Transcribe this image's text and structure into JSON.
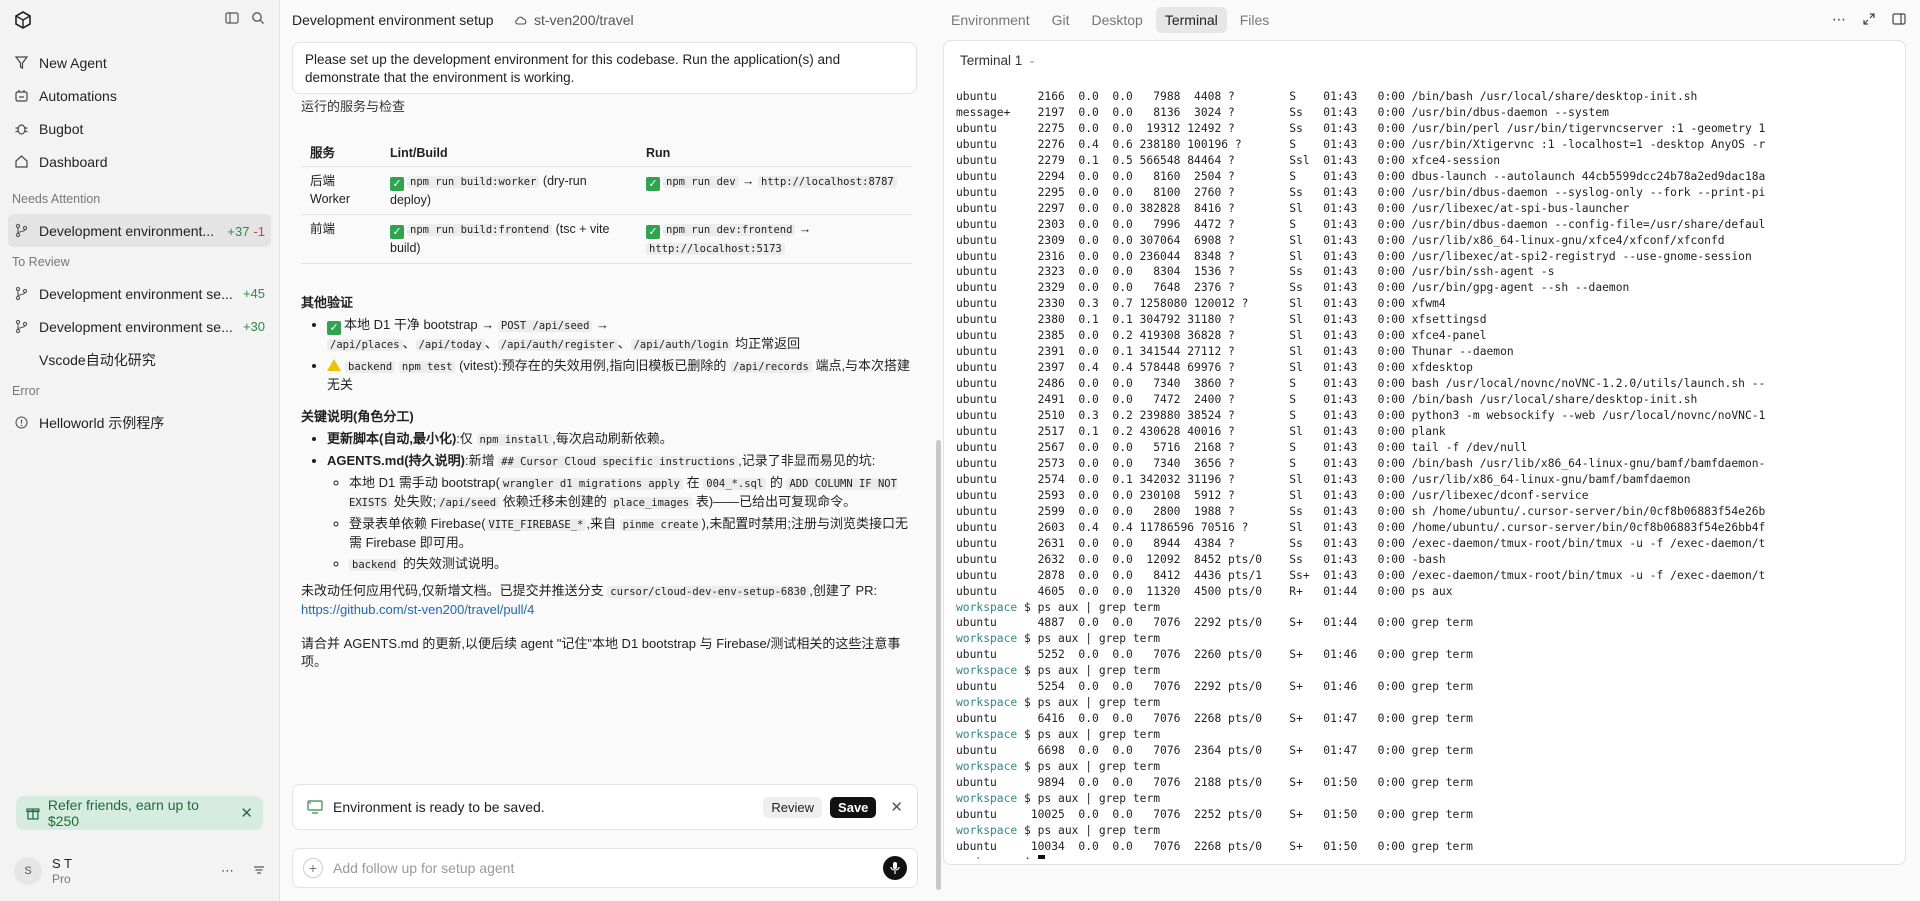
{
  "app": {
    "title": "Development environment setup",
    "repo": "st-ven200/travel"
  },
  "sidebar": {
    "nav": [
      {
        "label": "New Agent",
        "icon": "new-agent-icon"
      },
      {
        "label": "Automations",
        "icon": "automations-icon"
      },
      {
        "label": "Bugbot",
        "icon": "bug-icon"
      },
      {
        "label": "Dashboard",
        "icon": "home-icon"
      }
    ],
    "sections": {
      "needs_attention": "Needs Attention",
      "to_review": "To Review",
      "error": "Error"
    },
    "needs_attention": [
      {
        "title": "Development environment...",
        "added": "+37",
        "removed": "-1"
      }
    ],
    "to_review": [
      {
        "title": "Development environment se...",
        "added": "+45"
      },
      {
        "title": "Development environment se...",
        "added": "+30"
      },
      {
        "title": "Vscode自动化研究"
      }
    ],
    "errors": [
      {
        "title": "Helloworld 示例程序"
      }
    ],
    "refer": "Refer friends, earn up to $250",
    "user": {
      "initial": "S",
      "name": "S T",
      "plan": "Pro"
    }
  },
  "tabs": [
    "Environment",
    "Git",
    "Desktop",
    "Terminal",
    "Files"
  ],
  "chat": {
    "user_message": "Please set up the development environment for this codebase. Run the application(s) and demonstrate that the environment is working.",
    "running_heading": "运行的服务与检查",
    "table": {
      "headers": [
        "服务",
        "Lint/Build",
        "Run"
      ],
      "rows": [
        {
          "service": "后端 Worker",
          "build_code": "npm run build:worker",
          "build_note": "(dry-run deploy)",
          "run_code": "npm run dev",
          "run_url": "http://localhost:8787"
        },
        {
          "service": "前端",
          "build_code": "npm run build:frontend",
          "build_note": "(tsc + vite build)",
          "run_code": "npm run dev:frontend",
          "run_url": "http://localhost:5173"
        }
      ]
    },
    "other_heading": "其他验证",
    "other_1_pre": "本地 D1 干净 bootstrap →",
    "other_1_codes": [
      "POST /api/seed",
      "/api/places",
      "/api/today",
      "/api/auth/register",
      "/api/auth/login"
    ],
    "other_1_post": "均正常返回",
    "other_2_codes": [
      "backend",
      "npm test"
    ],
    "other_2_text": "(vitest):预存在的失效用例,指向旧模板已删除的",
    "other_2_code3": "/api/records",
    "other_2_post": "端点,与本次搭建无关",
    "key_heading": "关键说明(角色分工)",
    "key_1_bold": "更新脚本(自动,最小化)",
    "key_1_text": ":仅",
    "key_1_code": "npm install",
    "key_1_post": ",每次启动刷新依赖。",
    "key_2_bold": "AGENTS.md(持久说明)",
    "key_2_text": ":新增",
    "key_2_code": "## Cursor Cloud specific instructions",
    "key_2_post": ",记录了非显而易见的坑:",
    "sub_1_a": "本地 D1 需手动 bootstrap(",
    "sub_1_code1": "wrangler d1 migrations apply",
    "sub_1_b": "在",
    "sub_1_code2": "004_*.sql",
    "sub_1_c": "的",
    "sub_1_code3": "ADD COLUMN IF NOT EXISTS",
    "sub_1_d": "处失败;",
    "sub_1_code4": "/api/seed",
    "sub_1_e": "依赖迁移未创建的",
    "sub_1_code5": "place_images",
    "sub_1_f": "表)——已给出可复现命令。",
    "sub_2_a": "登录表单依赖 Firebase(",
    "sub_2_code1": "VITE_FIREBASE_*",
    "sub_2_b": ",来自",
    "sub_2_code2": "pinme create",
    "sub_2_c": "),未配置时禁用;注册与浏览类接口无需 Firebase 即可用。",
    "sub_3_code": "backend",
    "sub_3_text": "的失效测试说明。",
    "pr_text": "未改动任何应用代码,仅新增文档。已提交并推送分支",
    "pr_branch": "cursor/cloud-dev-env-setup-6830",
    "pr_post": ",创建了 PR:",
    "pr_link": "https://github.com/st-ven200/travel/pull/4",
    "closing": "请合并 AGENTS.md 的更新,以便后续 agent \"记住\"本地 D1 bootstrap 与 Firebase/测试相关的这些注意事项。",
    "ready_text": "Environment is ready to be saved.",
    "review_label": "Review",
    "save_label": "Save",
    "followup_placeholder": "Add follow up for setup agent"
  },
  "terminal": {
    "tab_label": "Terminal 1",
    "lines": [
      "ubuntu      2166  0.0  0.0   7988  4408 ?        S    01:43   0:00 /bin/bash /usr/local/share/desktop-init.sh",
      "message+    2197  0.0  0.0   8136  3024 ?        Ss   01:43   0:00 /usr/bin/dbus-daemon --system",
      "ubuntu      2275  0.0  0.0  19312 12492 ?        Ss   01:43   0:00 /usr/bin/perl /usr/bin/tigervncserver :1 -geometry 1",
      "ubuntu      2276  0.4  0.6 238180 100196 ?       S    01:43   0:00 /usr/bin/Xtigervnc :1 -localhost=1 -desktop AnyOS -r",
      "ubuntu      2279  0.1  0.5 566548 84464 ?        Ssl  01:43   0:00 xfce4-session",
      "ubuntu      2294  0.0  0.0   8160  2504 ?        S    01:43   0:00 dbus-launch --autolaunch 44cb5599dcc24b78a2ed9dac18a",
      "ubuntu      2295  0.0  0.0   8100  2760 ?        Ss   01:43   0:00 /usr/bin/dbus-daemon --syslog-only --fork --print-pi",
      "ubuntu      2297  0.0  0.0 382828  8416 ?        Sl   01:43   0:00 /usr/libexec/at-spi-bus-launcher",
      "ubuntu      2303  0.0  0.0   7996  4472 ?        S    01:43   0:00 /usr/bin/dbus-daemon --config-file=/usr/share/defaul",
      "ubuntu      2309  0.0  0.0 307064  6908 ?        Sl   01:43   0:00 /usr/lib/x86_64-linux-gnu/xfce4/xfconf/xfconfd",
      "ubuntu      2316  0.0  0.0 236044  8348 ?        Sl   01:43   0:00 /usr/libexec/at-spi2-registryd --use-gnome-session",
      "ubuntu      2323  0.0  0.0   8304  1536 ?        Ss   01:43   0:00 /usr/bin/ssh-agent -s",
      "ubuntu      2329  0.0  0.0   7648  2376 ?        Ss   01:43   0:00 /usr/bin/gpg-agent --sh --daemon",
      "ubuntu      2330  0.3  0.7 1258080 120012 ?      Sl   01:43   0:00 xfwm4",
      "ubuntu      2380  0.1  0.1 304792 31180 ?        Sl   01:43   0:00 xfsettingsd",
      "ubuntu      2385  0.0  0.2 419308 36828 ?        Sl   01:43   0:00 xfce4-panel",
      "ubuntu      2391  0.0  0.1 341544 27112 ?        Sl   01:43   0:00 Thunar --daemon",
      "ubuntu      2397  0.4  0.4 578448 69976 ?        Sl   01:43   0:00 xfdesktop",
      "ubuntu      2486  0.0  0.0   7340  3860 ?        S    01:43   0:00 bash /usr/local/novnc/noVNC-1.2.0/utils/launch.sh --",
      "ubuntu      2491  0.0  0.0   7472  2400 ?        S    01:43   0:00 /bin/bash /usr/local/share/desktop-init.sh",
      "ubuntu      2510  0.3  0.2 239880 38524 ?        S    01:43   0:00 python3 -m websockify --web /usr/local/novnc/noVNC-1",
      "ubuntu      2517  0.1  0.2 430628 40016 ?        Sl   01:43   0:00 plank",
      "ubuntu      2567  0.0  0.0   5716  2168 ?        S    01:43   0:00 tail -f /dev/null",
      "ubuntu      2573  0.0  0.0   7340  3656 ?        S    01:43   0:00 /bin/bash /usr/lib/x86_64-linux-gnu/bamf/bamfdaemon-",
      "ubuntu      2574  0.0  0.1 342032 31196 ?        Sl   01:43   0:00 /usr/lib/x86_64-linux-gnu/bamf/bamfdaemon",
      "ubuntu      2593  0.0  0.0 230108  5912 ?        Sl   01:43   0:00 /usr/libexec/dconf-service",
      "ubuntu      2599  0.0  0.0   2800  1988 ?        Ss   01:43   0:00 sh /home/ubuntu/.cursor-server/bin/0cf8b06883f54e26b",
      "ubuntu      2603  0.4  0.4 11786596 70516 ?      Sl   01:43   0:00 /home/ubuntu/.cursor-server/bin/0cf8b06883f54e26bb4f",
      "ubuntu      2631  0.0  0.0   8944  4384 ?        Ss   01:43   0:00 /exec-daemon/tmux-root/bin/tmux -u -f /exec-daemon/t",
      "ubuntu      2632  0.0  0.0  12092  8452 pts/0    Ss   01:43   0:00 -bash",
      "ubuntu      2878  0.0  0.0   8412  4436 pts/1    Ss+  01:43   0:00 /exec-daemon/tmux-root/bin/tmux -u -f /exec-daemon/t",
      "ubuntu      4605  0.0  0.0  11320  4500 pts/0    R+   01:44   0:00 ps aux",
      "$workspace $ ps aux | grep term",
      "ubuntu      4887  0.0  0.0   7076  2292 pts/0    S+   01:44   0:00 grep term",
      "$workspace $ ps aux | grep term",
      "ubuntu      5252  0.0  0.0   7076  2260 pts/0    S+   01:46   0:00 grep term",
      "$workspace $ ps aux | grep term",
      "ubuntu      5254  0.0  0.0   7076  2292 pts/0    S+   01:46   0:00 grep term",
      "$workspace $ ps aux | grep term",
      "ubuntu      6416  0.0  0.0   7076  2268 pts/0    S+   01:47   0:00 grep term",
      "$workspace $ ps aux | grep term",
      "ubuntu      6698  0.0  0.0   7076  2364 pts/0    S+   01:47   0:00 grep term",
      "$workspace $ ps aux | grep term",
      "ubuntu      9894  0.0  0.0   7076  2188 pts/0    S+   01:50   0:00 grep term",
      "$workspace $ ps aux | grep term",
      "ubuntu     10025  0.0  0.0   7076  2252 pts/0    S+   01:50   0:00 grep term",
      "$workspace $ ps aux | grep term",
      "ubuntu     10034  0.0  0.0   7076  2268 pts/0    S+   01:50   0:00 grep term"
    ],
    "prompt_label": "workspace",
    "final_prompt": "workspace $ "
  },
  "colors": {
    "accent_green": "#2e8b45",
    "accent_red": "#cc4444",
    "prompt": "#2b8a8a",
    "link": "#1b66c9"
  }
}
